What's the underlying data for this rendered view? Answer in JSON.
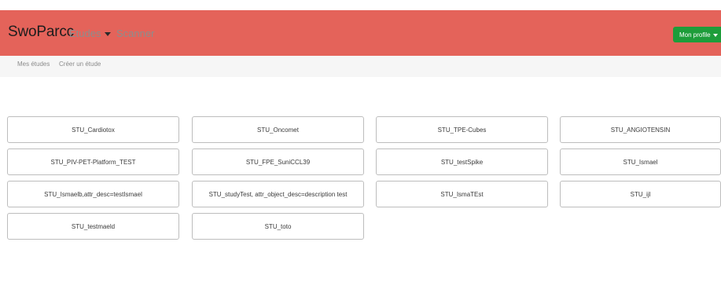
{
  "navbar": {
    "brand": "SwoParcc",
    "etudes_label": "Etudes",
    "scanner_label": "Scanner",
    "profile_label": "Mon profile",
    "background_color": "#e4635a",
    "profile_color": "#1e9d3a"
  },
  "subnav": {
    "items": [
      {
        "label": "Mes études"
      },
      {
        "label": "Créer un étude"
      }
    ]
  },
  "studies": [
    {
      "label": "STU_Cardiotox"
    },
    {
      "label": "STU_Oncomet"
    },
    {
      "label": "STU_TPE-Cubes"
    },
    {
      "label": "STU_ANGIOTENSIN"
    },
    {
      "label": "STU_PIV-PET-Platform_TEST"
    },
    {
      "label": "STU_FPE_SuniCCL39"
    },
    {
      "label": "STU_testSpike"
    },
    {
      "label": "STU_Ismael"
    },
    {
      "label": "STU_Ismaelb,attr_desc=testIsmael"
    },
    {
      "label": "STU_studyTest, attr_object_desc=description test"
    },
    {
      "label": "STU_IsmaTEst"
    },
    {
      "label": "STU_ijl"
    },
    {
      "label": "STU_testmaeld"
    },
    {
      "label": "STU_toto"
    }
  ]
}
